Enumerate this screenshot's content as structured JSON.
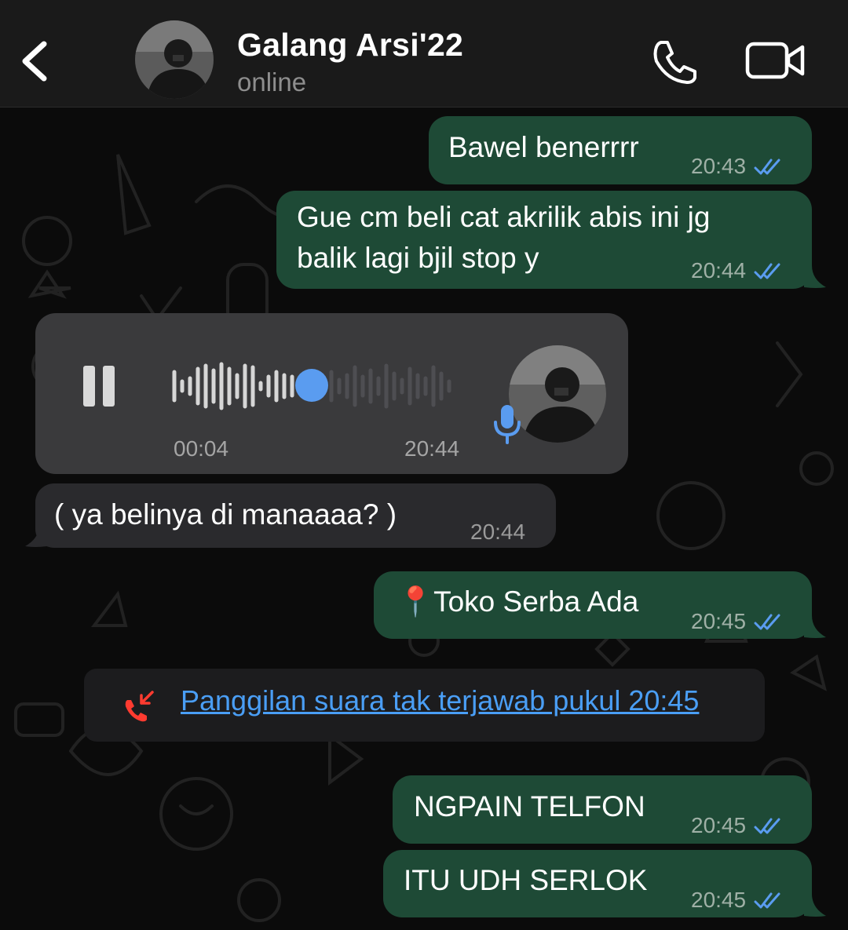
{
  "header": {
    "contact_name": "Galang Arsi'22",
    "status": "online",
    "icons": [
      "back-chevron-icon",
      "phone-icon",
      "video-camera-icon"
    ]
  },
  "messages": [
    {
      "direction": "outgoing",
      "text": "Bawel benerrrr",
      "time": "20:43",
      "read": true
    },
    {
      "direction": "outgoing",
      "text_lines": [
        "Gue cm beli cat akrilik abis ini jg",
        "balik lagi bjil stop y"
      ],
      "time": "20:44",
      "read": true
    },
    {
      "direction": "incoming",
      "type": "voice",
      "duration": "00:04",
      "time": "20:44",
      "playback_progress": 0.48
    },
    {
      "direction": "incoming",
      "text": "( ya belinya di manaaaa? )",
      "time": "20:44"
    },
    {
      "direction": "outgoing",
      "emoji": "📍",
      "text": "Toko Serba Ada",
      "time": "20:45",
      "read": true
    },
    {
      "type": "missed_call",
      "text": "Panggilan suara tak terjawab pukul 20:45"
    },
    {
      "direction": "outgoing",
      "text": "NGPAIN TELFON",
      "time": "20:45",
      "read": true
    },
    {
      "direction": "outgoing",
      "text": "ITU UDH SERLOK",
      "time": "20:45",
      "read": true
    }
  ],
  "colors": {
    "outgoing_bubble": "#1e4a36",
    "incoming_bubble": "#2a2a2d",
    "voice_bubble": "#3a3a3c",
    "read_ticks": "#5a9cf0",
    "missed_call_icon": "#ff3b30",
    "link": "#4a9ef5"
  }
}
